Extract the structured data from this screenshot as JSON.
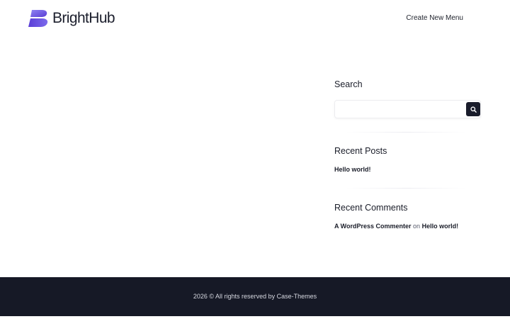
{
  "header": {
    "logo_text": "BrightHub",
    "nav_link": "Create New Menu"
  },
  "sidebar": {
    "search": {
      "title": "Search",
      "placeholder": "",
      "button_icon": "search-icon"
    },
    "recent_posts": {
      "title": "Recent Posts",
      "items": [
        {
          "label": "Hello world!"
        }
      ]
    },
    "recent_comments": {
      "title": "Recent Comments",
      "items": [
        {
          "author": "A WordPress Commenter",
          "connector": "on",
          "post": "Hello world!"
        }
      ]
    }
  },
  "footer": {
    "copyright": "2026 © All rights reserved by Case-Themes"
  },
  "colors": {
    "brand_gradient_start": "#5b3fd6",
    "brand_gradient_end": "#8a7cf0",
    "dark": "#161926",
    "button": "#191c2b"
  }
}
